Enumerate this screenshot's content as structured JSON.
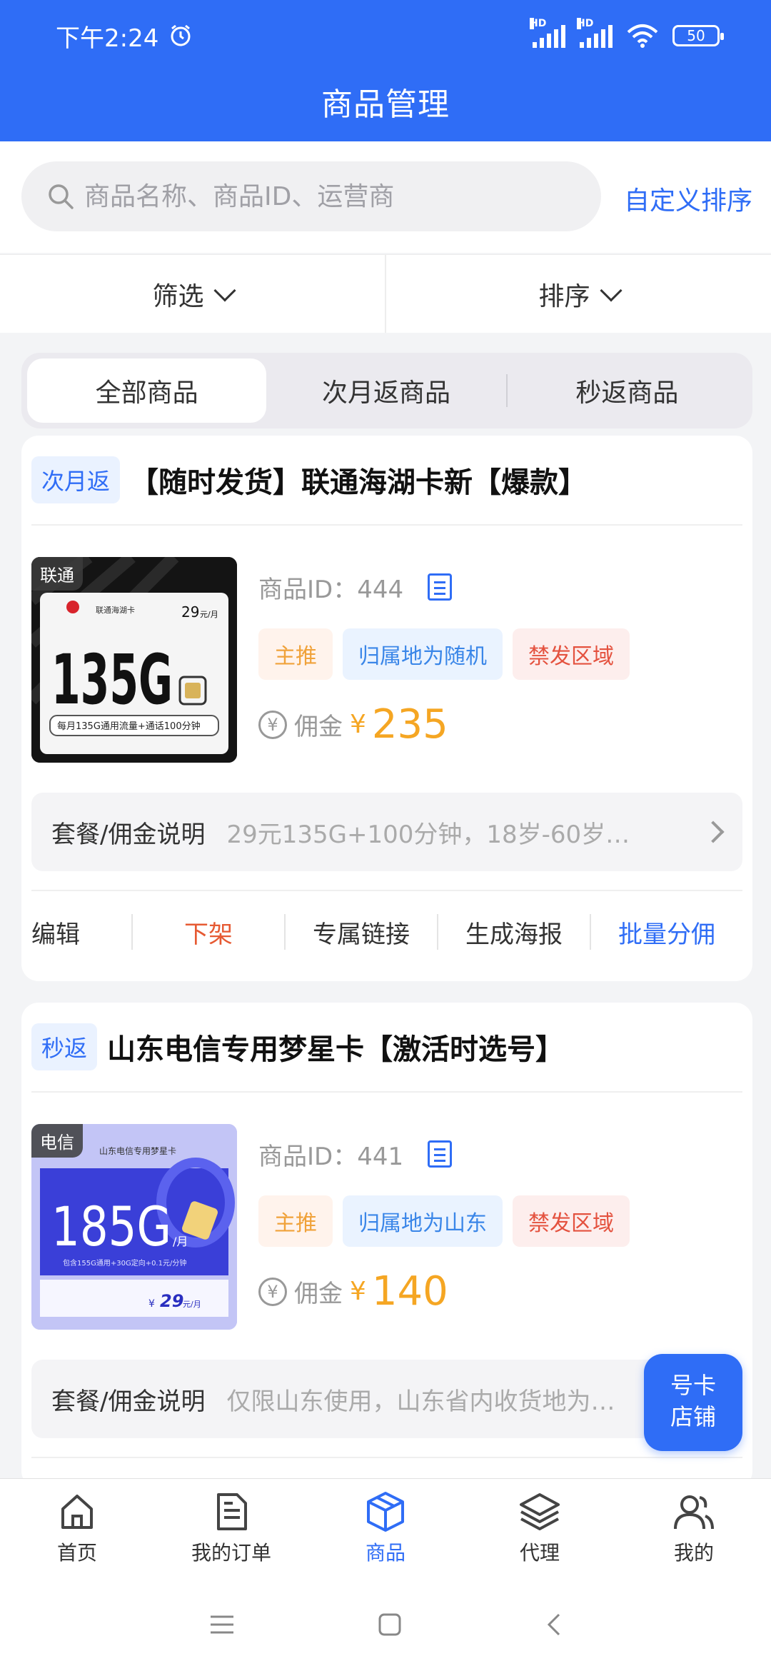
{
  "status_bar": {
    "time": "下午2:24",
    "battery": "50",
    "signal_label": "HD"
  },
  "header": {
    "title": "商品管理"
  },
  "search": {
    "placeholder": "商品名称、商品ID、运营商",
    "custom_sort": "自定义排序"
  },
  "filters": {
    "filter_label": "筛选",
    "sort_label": "排序"
  },
  "tabs": [
    "全部商品",
    "次月返商品",
    "秒返商品"
  ],
  "products": [
    {
      "type_badge": "次月返",
      "title": "【随时发货】联通海湖卡新【爆款】",
      "carrier_tag": "联通",
      "product_id": "商品ID：444",
      "tags": [
        "主推",
        "归属地为随机",
        "禁发区域"
      ],
      "commission_label": "佣金",
      "currency": "¥",
      "commission": "235",
      "desc_label": "套餐/佣金说明",
      "desc": "29元135G+100分钟，18岁-60岁…",
      "card_image": {
        "brand": "联通海湖卡",
        "data": "135G",
        "price": "29",
        "price_unit": "元/月",
        "note": "每月135G通用流量+通话100分钟"
      }
    },
    {
      "type_badge": "秒返",
      "title": "山东电信专用梦星卡【激活时选号】",
      "carrier_tag": "电信",
      "product_id": "商品ID：441",
      "tags": [
        "主推",
        "归属地为山东",
        "禁发区域"
      ],
      "commission_label": "佣金",
      "currency": "¥",
      "commission": "140",
      "desc_label": "套餐/佣金说明",
      "desc": "仅限山东使用，山东省内收货地为…",
      "card_image": {
        "brand": "山东电信专用梦星卡",
        "data": "185G",
        "per": "/月",
        "price": "29",
        "price_unit": "元/月",
        "note": "包含155G通用+30G定向+0.1元/分钟"
      }
    }
  ],
  "actions": [
    "编辑",
    "下架",
    "专属链接",
    "生成海报",
    "批量分佣"
  ],
  "fab": {
    "line1": "号卡",
    "line2": "店铺"
  },
  "bottom_nav": [
    "首页",
    "我的订单",
    "商品",
    "代理",
    "我的"
  ],
  "colors": {
    "primary": "#2f6df6",
    "commission": "#f5a623",
    "tag_main": "#f0a23a",
    "tag_ban": "#e4523f",
    "action_red": "#e65a33"
  }
}
